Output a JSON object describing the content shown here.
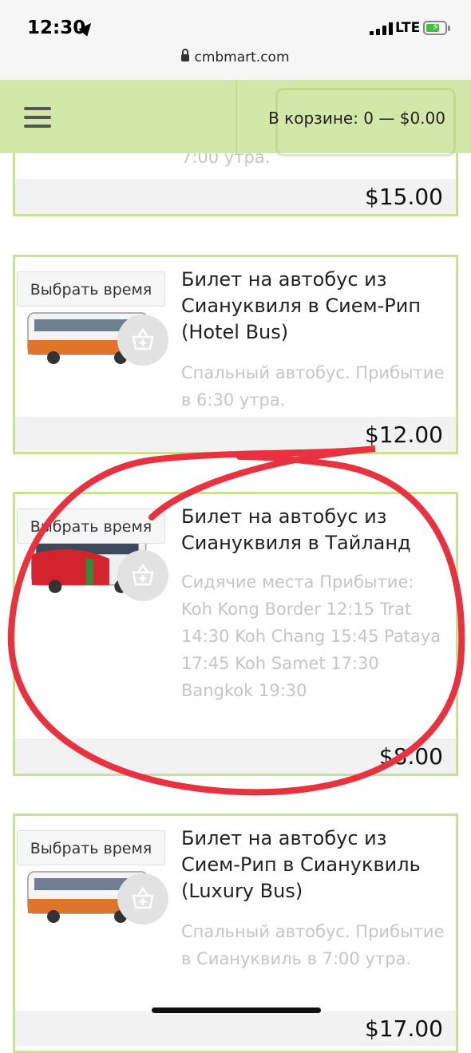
{
  "status_bar": {
    "time": "12:30",
    "network": "LTE"
  },
  "browser": {
    "url": "cmbmart.com"
  },
  "header": {
    "cart_label": "В корзине: 0 — $0.00"
  },
  "products": [
    {
      "title": "",
      "description": "7:00 утра.",
      "price": "$15.00"
    },
    {
      "title": "Билет на автобус из Сиануквиля в Сием-Рип (Hotel Bus)",
      "description": "Спальный автобус. Прибытие в 6:30 утра.",
      "price": "$12.00",
      "choose_time": "Выбрать время"
    },
    {
      "title": "Билет на автобус из Сиануквиля в Тайланд",
      "description": "Сидячие места Прибытие: Koh Kong Border 12:15 Trat 14:30 Koh Chang 15:45 Pataya 17:45 Koh Samet 17:30 Bangkok 19:30",
      "price": "$8.00",
      "choose_time": "Выбрать время"
    },
    {
      "title": "Билет на автобус из Сием-Рип в Сиануквиль (Luxury Bus)",
      "description": "Спальный автобус. Прибытие в Сиануквиль в 7:00 утра.",
      "price": "$17.00",
      "choose_time": "Выбрать время"
    }
  ],
  "colors": {
    "accent": "#d2e8a8",
    "border": "#c8e28f",
    "annotation": "#e8323f"
  }
}
